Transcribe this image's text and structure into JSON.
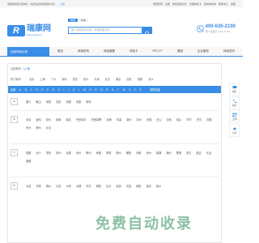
{
  "topbar": {
    "welcome": "瑞康体检网-查体检,一站式在线体检服务平台",
    "city": "上海",
    "links": [
      "瑞康登录",
      "注册",
      "体检套餐对比",
      "管理体检卡",
      "我的体检单",
      "帮助中心",
      "收藏"
    ]
  },
  "logo": {
    "mark": "R",
    "name": "瑞康网",
    "url": "www.rkang.cn"
  },
  "search": {
    "tabs": [
      "体检",
      "机构"
    ],
    "placeholder": "输入体检机构名称、体检套餐名称"
  },
  "hotline": {
    "number": "400-630-2100",
    "time": "周一至周五 8:30-17:30"
  },
  "nav": {
    "all_label": "全部体检分类",
    "items": [
      "首页",
      "体检机构",
      "体检套餐",
      "体检卡",
      "PET-CT",
      "基因",
      "企业服务",
      "体检资讯"
    ]
  },
  "current_city": {
    "label": "当前城市：",
    "value": "[上海]"
  },
  "hot_cities": [
    "热门城市：",
    "北京",
    "上海",
    "广州",
    "深圳",
    "重庆",
    "杭州",
    "天津",
    "武汉",
    "南京",
    "西安",
    "成都",
    "苏州"
  ],
  "letters": [
    "全部",
    "A",
    "B",
    "C",
    "D",
    "E",
    "F",
    "G",
    "H",
    "I",
    "J",
    "K",
    "L",
    "M",
    "N",
    "P",
    "Q",
    "R",
    "S",
    "T",
    "W",
    "X",
    "Y",
    "Z"
  ],
  "letters_hot": "按照热度",
  "groups": [
    {
      "letter": "A",
      "cities": [
        "澳门",
        "鞍山",
        "安阳",
        "安庆",
        "安顺",
        "安康",
        "阿坝"
      ]
    },
    {
      "letter": "B",
      "cities": [
        "北京",
        "宝鸡",
        "包头",
        "蚌埠",
        "保定",
        "巴彦淖尔",
        "巴音郭楞",
        "北海",
        "本溪",
        "滨州",
        "亳州",
        "白城",
        "白山",
        "百色",
        "保山",
        "毕节",
        "巴中",
        "白银",
        "巴州",
        "博州",
        "北屯"
      ]
    },
    {
      "letter": "C",
      "cities": [
        "成都",
        "长沙",
        "重庆",
        "常州",
        "长春",
        "沧州",
        "郴州",
        "承德",
        "常德",
        "滁州",
        "朝阳",
        "赤峰",
        "池州",
        "巢湖",
        "潮州",
        "楚雄",
        "崇左",
        "昌吉",
        "长治",
        "昌都"
      ]
    },
    {
      "letter": "D",
      "cities": [
        "大连",
        "东莞",
        "德州",
        "大庆",
        "大同",
        "大理",
        "丹东",
        "德阳",
        "达州",
        "定西",
        "东营",
        "德宏",
        "迪庆",
        "儋州"
      ]
    }
  ],
  "sidebar": [
    "客服",
    "电话",
    "二维码",
    "顶部"
  ],
  "watermark": "免费自动收录",
  "colors": {
    "brand": "#3a8de6",
    "watermark": "#2e8c5a"
  }
}
